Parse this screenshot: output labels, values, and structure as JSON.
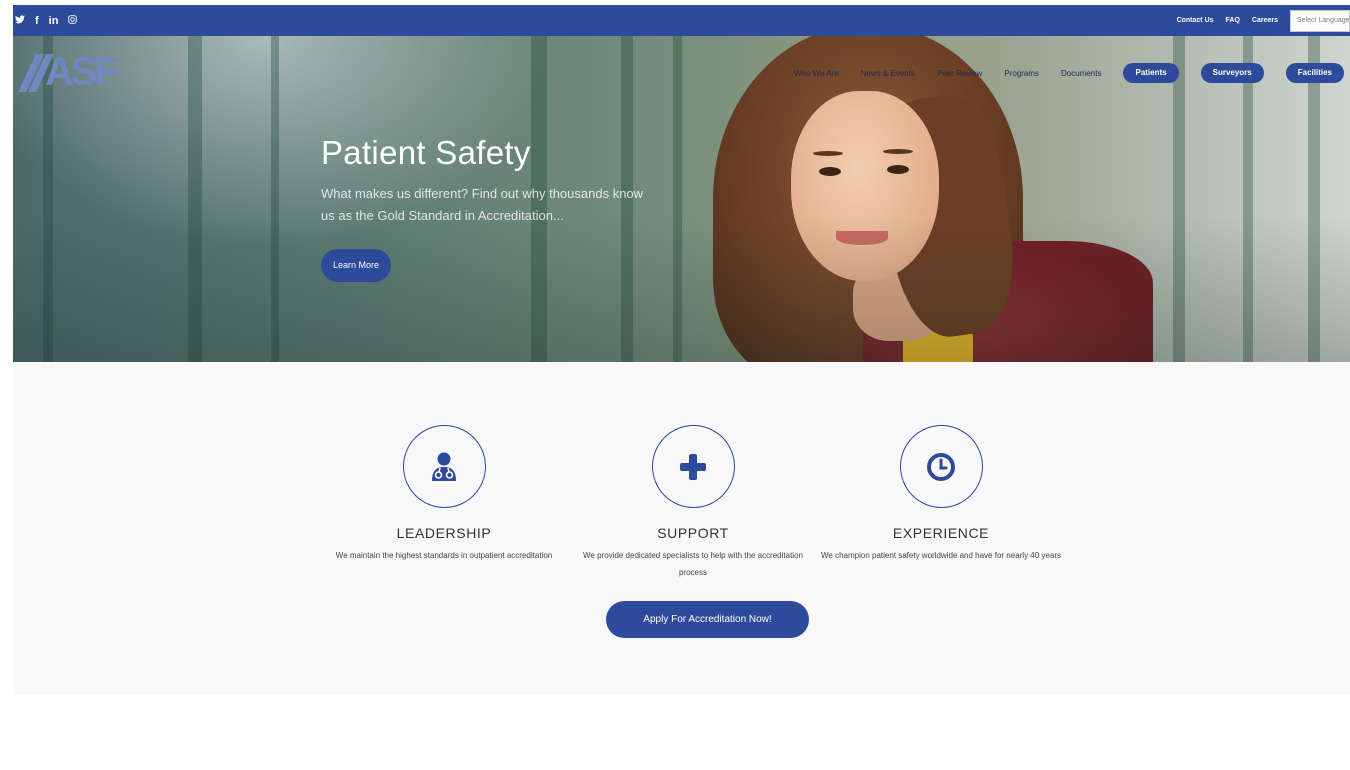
{
  "topbar": {
    "social": [
      {
        "icon": "twitter-icon",
        "glyph": "✔"
      },
      {
        "icon": "facebook-icon",
        "glyph": "f"
      },
      {
        "icon": "linkedin-icon",
        "glyph": "in"
      },
      {
        "icon": "instagram-icon",
        "glyph": "◎"
      }
    ],
    "links": [
      "Contact Us",
      "FAQ",
      "Careers"
    ],
    "language_select": {
      "placeholder": "Select Language"
    }
  },
  "brand": {
    "logo_text": "ASF",
    "color": "#2e4a9a"
  },
  "nav": {
    "links": [
      "Who We Are",
      "News & Events",
      "Peer Review",
      "Programs",
      "Documents"
    ],
    "pills": [
      "Patients",
      "Surveyors",
      "Facilities"
    ]
  },
  "hero": {
    "title": "Patient Safety",
    "subtitle": "What makes us different? Find out why thousands know us as the Gold Standard in Accreditation...",
    "button": "Learn More"
  },
  "features": [
    {
      "icon": "doctor-icon",
      "title": "LEADERSHIP",
      "text": "We maintain the highest standards in outpatient accreditation"
    },
    {
      "icon": "plus-icon",
      "title": "SUPPORT",
      "text": "We provide dedicated specialists to help with the accreditation process"
    },
    {
      "icon": "clock-icon",
      "title": "EXPERIENCE",
      "text": "We champion patient safety worldwide and have for nearly 40 years"
    }
  ],
  "cta": {
    "label": "Apply For Accreditation Now!"
  }
}
